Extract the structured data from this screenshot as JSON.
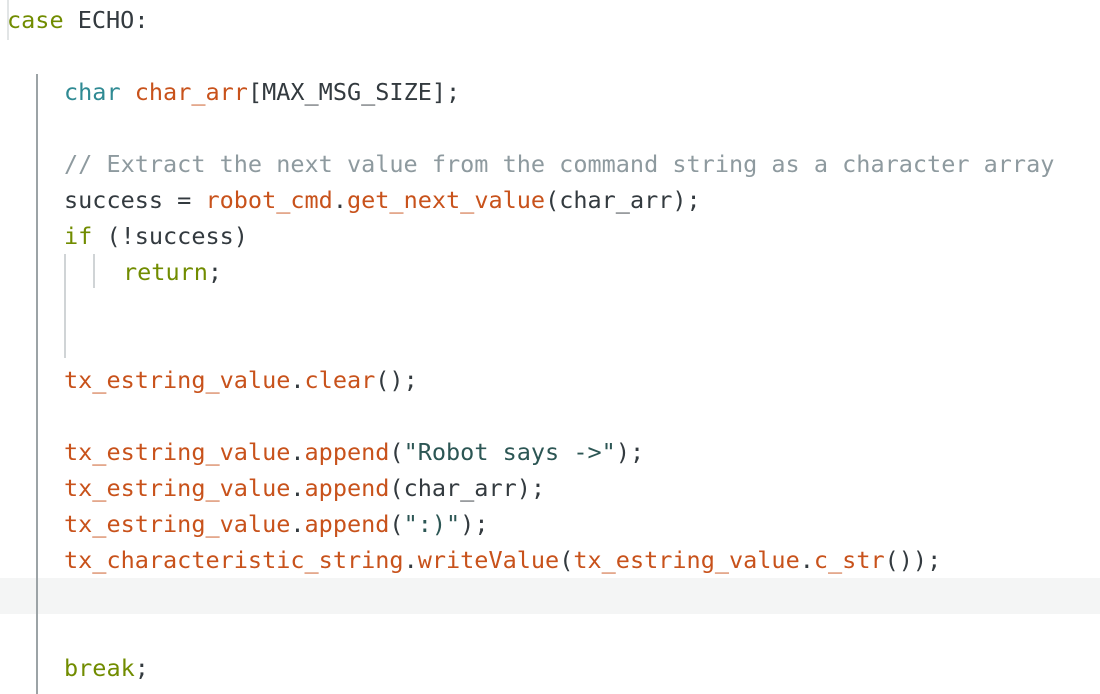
{
  "colors": {
    "background": "#ffffff",
    "keyword_olive": "#718c00",
    "type_teal": "#2f8a93",
    "identifier_orange": "#c8521b",
    "comment_gray": "#8e9a9f",
    "plain": "#333a3f",
    "string_dark_teal": "#2c5654",
    "current_line_highlight": "#f4f5f5"
  },
  "editor": {
    "lines": [
      {
        "tokens": [
          {
            "t": "case",
            "k": "keyword"
          },
          {
            "t": " ECHO:",
            "k": "plain"
          }
        ]
      },
      {
        "tokens": []
      },
      {
        "tokens": [
          {
            "t": "char",
            "k": "type"
          },
          {
            "t": " ",
            "k": "plain"
          },
          {
            "t": "char_arr",
            "k": "ident"
          },
          {
            "t": "[MAX_MSG_SIZE];",
            "k": "plain"
          }
        ]
      },
      {
        "tokens": []
      },
      {
        "tokens": [
          {
            "t": "// Extract the next value from the command string as a character array",
            "k": "comment"
          }
        ]
      },
      {
        "tokens": [
          {
            "t": "success = ",
            "k": "plain"
          },
          {
            "t": "robot_cmd",
            "k": "ident"
          },
          {
            "t": ".",
            "k": "plain"
          },
          {
            "t": "get_next_value",
            "k": "method"
          },
          {
            "t": "(char_arr);",
            "k": "plain"
          }
        ]
      },
      {
        "tokens": [
          {
            "t": "if",
            "k": "keyword"
          },
          {
            "t": " (!success)",
            "k": "plain"
          }
        ]
      },
      {
        "tokens": [
          {
            "t": "return",
            "k": "keyword"
          },
          {
            "t": ";",
            "k": "plain"
          }
        ]
      },
      {
        "tokens": []
      },
      {
        "tokens": []
      },
      {
        "tokens": [
          {
            "t": "tx_estring_value",
            "k": "ident"
          },
          {
            "t": ".",
            "k": "plain"
          },
          {
            "t": "clear",
            "k": "method"
          },
          {
            "t": "();",
            "k": "plain"
          }
        ]
      },
      {
        "tokens": []
      },
      {
        "tokens": [
          {
            "t": "tx_estring_value",
            "k": "ident"
          },
          {
            "t": ".",
            "k": "plain"
          },
          {
            "t": "append",
            "k": "method"
          },
          {
            "t": "(",
            "k": "plain"
          },
          {
            "t": "\"Robot says ->\"",
            "k": "string"
          },
          {
            "t": ");",
            "k": "plain"
          }
        ]
      },
      {
        "tokens": [
          {
            "t": "tx_estring_value",
            "k": "ident"
          },
          {
            "t": ".",
            "k": "plain"
          },
          {
            "t": "append",
            "k": "method"
          },
          {
            "t": "(char_arr);",
            "k": "plain"
          }
        ]
      },
      {
        "tokens": [
          {
            "t": "tx_estring_value",
            "k": "ident"
          },
          {
            "t": ".",
            "k": "plain"
          },
          {
            "t": "append",
            "k": "method"
          },
          {
            "t": "(",
            "k": "plain"
          },
          {
            "t": "\":)\"",
            "k": "string"
          },
          {
            "t": ");",
            "k": "plain"
          }
        ]
      },
      {
        "tokens": [
          {
            "t": "tx_characteristic_string",
            "k": "ident"
          },
          {
            "t": ".",
            "k": "plain"
          },
          {
            "t": "writeValue",
            "k": "method"
          },
          {
            "t": "(",
            "k": "plain"
          },
          {
            "t": "tx_estring_value",
            "k": "ident"
          },
          {
            "t": ".",
            "k": "plain"
          },
          {
            "t": "c_str",
            "k": "method"
          },
          {
            "t": "());",
            "k": "plain"
          }
        ]
      },
      {
        "tokens": []
      },
      {
        "tokens": []
      },
      {
        "tokens": [
          {
            "t": "break",
            "k": "keyword"
          },
          {
            "t": ";",
            "k": "plain"
          }
        ]
      }
    ]
  }
}
